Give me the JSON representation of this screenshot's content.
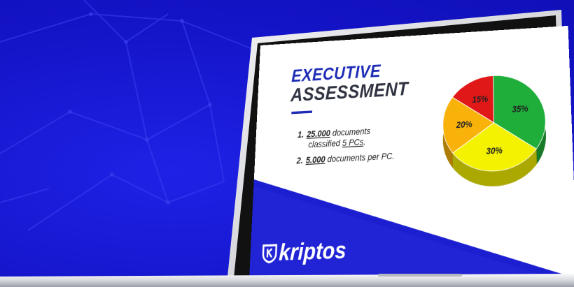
{
  "slide": {
    "title_line1": "EXECUTIVE",
    "title_line2": "ASSESSMENT",
    "items": [
      {
        "number": "1.",
        "count": "25.000",
        "text_after_count": " documents",
        "line2_prefix": "classified ",
        "pcs": "5 PCs",
        "line2_suffix": "."
      },
      {
        "number": "2.",
        "count": "5.000",
        "text_after_count": " documents per PC."
      }
    ],
    "brand": "kriptos"
  },
  "pie": {
    "slices": [
      {
        "label": "35%",
        "value": 35,
        "color": "#1fae3a"
      },
      {
        "label": "30%",
        "value": 30,
        "color": "#f4f200"
      },
      {
        "label": "20%",
        "value": 20,
        "color": "#f9b20a"
      },
      {
        "label": "15%",
        "value": 15,
        "color": "#e11818"
      }
    ]
  },
  "colors": {
    "background": "#1414c8",
    "accent": "#1d2bb5"
  },
  "icons": {
    "brand_logo": "shield-k-icon"
  }
}
